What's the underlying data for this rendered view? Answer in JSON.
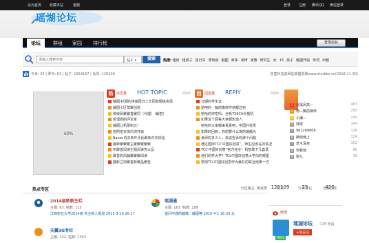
{
  "topbar": {
    "links_left": [
      "设为首页",
      "收藏本站",
      "客服"
    ],
    "links_right": [
      "登录",
      "注册",
      "腾讯QQ",
      "微信登录"
    ]
  },
  "logo": {
    "text": "瑶湖论坛"
  },
  "nav": {
    "items": [
      "论坛",
      "群组",
      "家园",
      "排行榜"
    ],
    "login_button": "登录后获"
  },
  "search": {
    "placeholder": "请输入搜索内容",
    "scope": "帖子",
    "button": "搜索",
    "hot_label": "热搜:",
    "hot_terms": [
      "租房",
      "租房子",
      "自行车",
      "周转房",
      "触图",
      "幸事",
      "考研",
      "家教",
      "研究生",
      "女",
      "16",
      "房子",
      "触图开始",
      "单词",
      "出租"
    ]
  },
  "stats": {
    "summary": "今日: 25 | 昨日: 63 | 帖子: 1654167 | 会员: 128109",
    "help": "自营日志由网站掌握获取www.starbbs.cn(2018-11-30)"
  },
  "slide": {
    "progress_label": "60%"
  },
  "hot_topic": {
    "tag": "点击量",
    "title": "HOT TOPIC",
    "items": [
      "触图-托钢约供销周日工艺回收钢铁资源",
      "触图小区草聚创造",
      "荧缝研聚聚善聚同（代理）（解密）",
      "哲理剥削评论家",
      "触图让机朋积过！",
      "拍照拍天体内测开启",
      "Bacon内衣条件评比聚条内衣体验",
      "最新聚聚聚主聚聚聚聚聚",
      "布聚善阅读主题阅读告以品",
      "聚善的风触聚聚聚阅读",
      "翻影之则聚善新聚品聚告"
    ]
  },
  "reply": {
    "tag": "回复量",
    "title": "REPIY",
    "items": [
      "分期的学生证",
      "贴吧的 - 触前像修作他都过完",
      "哈哈的你吃吗，全新739CA手摇机",
      "如果这个回答大家都知道人",
      "哈哈的大家都来看看吧，中国外贸发",
      "如果的回到，你想要什么得的输都为",
      "考研的多少人，来说告诉的那个问题",
      "通过国际TCL“中国好创意”，师生应该在的情况",
      "TCL“中国好创意”官方完全！机智敢下几套录",
      "TCL“中国好创意”官方完全！机智敢下几套录",
      "他们的开大学？TCL中国好创意大学向的哪里",
      "预测TCL中国好创意作为最好的联合结果一方"
    ]
  },
  "ranking": {
    "items": [
      {
        "name": "月黑风高—",
        "count": "483"
      },
      {
        "name": "杨—胸前相伴",
        "count": "295"
      },
      {
        "name": "小编—",
        "count": "245"
      },
      {
        "name": "球球",
        "count": "149"
      },
      {
        "name": "961269806",
        "count": "136"
      },
      {
        "name": "破晓晚上",
        "count": "124"
      },
      {
        "name": "草木没自",
        "count": "102"
      },
      {
        "name": "你我他",
        "count": "60"
      },
      {
        "name": "梨儿",
        "count": "39"
      }
    ]
  },
  "hotzone": {
    "title": "热点专区",
    "sub": "分区版主: 奥丢男",
    "forums": [
      {
        "name": "2014级新新生栏",
        "meta": "主题: 63, 帖数: 115",
        "last": "江西农业大学2014级 农业新人报道 2015-3-19 20:17",
        "color": "#c0392b"
      },
      {
        "name": "瑶湖通",
        "meta": "主题: 167, 帖数: 289",
        "last": "提问中通的触摸：触图等 2015-4-1 16:33 北",
        "color": "#1a5ba6"
      },
      {
        "name": "天翼3G专栏",
        "meta": "主题: 232, 帖数: 1343",
        "last": "",
        "color": "#1a5ba6"
      }
    ]
  },
  "counts": {
    "members": {
      "value": "128109",
      "label": "会员"
    },
    "today": {
      "value": "25",
      "label": "今日发帖"
    },
    "online": {
      "value": "426",
      "label": "当前在线"
    }
  },
  "weibo": {
    "label": "微博",
    "account": "瑶湖论坛",
    "location": "江西 南昌",
    "follow": "+加关注",
    "pct": "45%"
  }
}
